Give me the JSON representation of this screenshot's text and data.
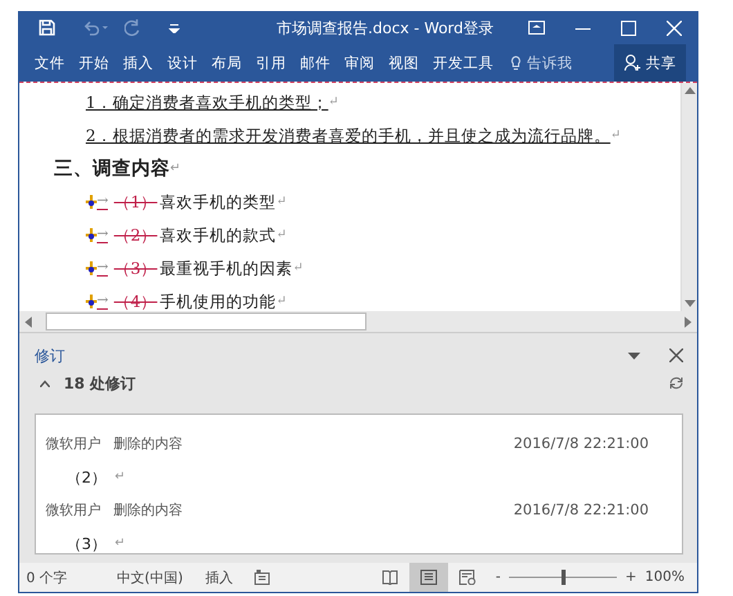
{
  "window": {
    "title": "市场调查报告.docx - Word",
    "sign_in": "登录",
    "quick_access": [
      {
        "kind": "save",
        "disabled": false
      },
      {
        "kind": "undo",
        "disabled": true
      },
      {
        "kind": "redo",
        "disabled": true
      },
      {
        "kind": "customize",
        "disabled": false
      }
    ]
  },
  "ribbon": {
    "tabs": [
      {
        "label": "文件",
        "selected": false
      },
      {
        "label": "开始",
        "selected": false
      },
      {
        "label": "插入",
        "selected": false
      },
      {
        "label": "设计",
        "selected": false
      },
      {
        "label": "布局",
        "selected": false
      },
      {
        "label": "引用",
        "selected": false
      },
      {
        "label": "邮件",
        "selected": false
      },
      {
        "label": "审阅",
        "selected": false
      },
      {
        "label": "视图",
        "selected": false
      },
      {
        "label": "开发工具",
        "selected": false
      }
    ],
    "tell_me": "告诉我",
    "share": "共享"
  },
  "document": {
    "paragraphs": [
      {
        "kind": "inserted",
        "text": "1．确定消费者喜欢手机的类型；",
        "end_mark": "↵"
      },
      {
        "kind": "inserted",
        "text": "2．根据消费者的需求开发消费者喜爱的手机，并且使之成为流行品牌。",
        "end_mark": "↵"
      },
      {
        "kind": "heading",
        "text": "三、调查内容",
        "end_mark": "↵"
      },
      {
        "kind": "revised",
        "tab": "→",
        "deleted": "（1）",
        "text": "喜欢手机的类型",
        "end_mark": "↵"
      },
      {
        "kind": "revised",
        "tab": "→",
        "deleted": "（2）",
        "text": "喜欢手机的款式",
        "end_mark": "↵"
      },
      {
        "kind": "revised",
        "tab": "→",
        "deleted": "（3）",
        "text": "最重视手机的因素",
        "end_mark": "↵"
      },
      {
        "kind": "revised",
        "tab": "→",
        "deleted": "（4）",
        "text": "手机使用的功能",
        "end_mark": "↵"
      }
    ]
  },
  "revisions_pane": {
    "title": "修订",
    "summary": "18 处修订",
    "expanded": true,
    "entries": [
      {
        "author": "微软用户",
        "action": "删除的内容",
        "time": "2016/7/8 22:21:00",
        "content": "（2）",
        "end_mark": "↵"
      },
      {
        "author": "微软用户",
        "action": "删除的内容",
        "time": "2016/7/8 22:21:00",
        "content": "（3）",
        "end_mark": "↵"
      }
    ]
  },
  "status_bar": {
    "word_count": "0 个字",
    "language": "中文(中国)",
    "mode": "插入",
    "views": [
      {
        "kind": "read",
        "selected": false
      },
      {
        "kind": "print",
        "selected": true
      },
      {
        "kind": "web",
        "selected": false
      }
    ],
    "zoom": {
      "minus": "-",
      "plus": "+",
      "level": 0.5,
      "reading": "100%"
    }
  }
}
